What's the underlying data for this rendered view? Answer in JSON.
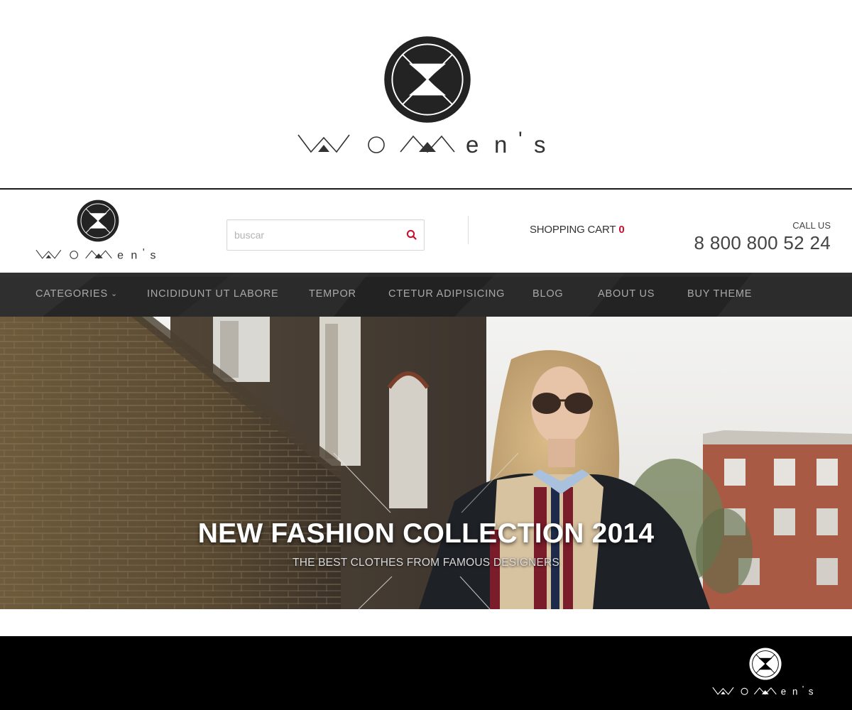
{
  "brand": {
    "name": "women's",
    "wordmark_letters": [
      "e",
      "n",
      "'",
      "s"
    ]
  },
  "search": {
    "placeholder": "buscar"
  },
  "cart": {
    "label": "SHOPPING CART",
    "count": "0"
  },
  "contact": {
    "label": "CALL US",
    "phone": "8 800 800 52 24"
  },
  "nav": {
    "items": [
      {
        "label": "CATEGORIES",
        "has_dropdown": true
      },
      {
        "label": "INCIDIDUNT UT LABORE"
      },
      {
        "label": "TEMPOR"
      },
      {
        "label": "CTETUR ADIPISICING"
      },
      {
        "label": "BLOG"
      },
      {
        "label": "ABOUT US"
      },
      {
        "label": "BUY THEME"
      }
    ]
  },
  "hero": {
    "title": "NEW FASHION COLLECTION 2014",
    "subtitle": "THE BEST CLOTHES FROM FAMOUS DESIGNERS"
  },
  "icons": {
    "search": "search-icon",
    "dropdown": "chevron-down-icon",
    "logo_mark": "hourglass-circle-logo"
  },
  "colors": {
    "accent": "#c8102e",
    "nav_bg": "#242424",
    "nav_text": "#a9a9a9",
    "footer_bg": "#000000"
  }
}
